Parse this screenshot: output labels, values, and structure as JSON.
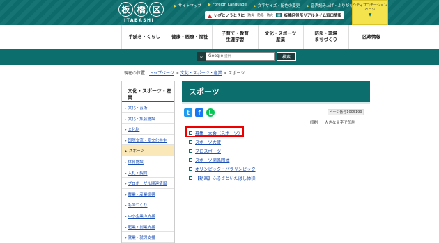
{
  "header": {
    "logo_kanji": [
      "板",
      "橋",
      "区"
    ],
    "logo_roman": "ITABASHI",
    "top_links": [
      "サイトマップ",
      "Foreign Language",
      "文字サイズ・配色の変更",
      "音声読み上げ・ふりがな"
    ],
    "emergency_label": "いざというときに",
    "emergency_sub": "(防災・防犯・防火)",
    "building_label": "板橋区役所リアルタイム窓口情報",
    "promo_text": "シティプロモーションページ"
  },
  "nav": [
    "手続き・くらし",
    "健康・医療・福祉",
    "子育て・教育\n生涯学習",
    "文化・スポーツ\n産業",
    "防災・環境\nまちづくり",
    "区政情報"
  ],
  "search": {
    "placeholder": "Google",
    "placeholder_sub": "提供",
    "button": "検索"
  },
  "breadcrumb": {
    "prefix": "現在の位置：",
    "items": [
      "トップページ",
      "文化・スポーツ・産業"
    ],
    "current": "スポーツ",
    "sep": " > "
  },
  "sidebar": {
    "heading": "文化・スポーツ・産業",
    "items": [
      "文化・芸術",
      "文化・集会施設",
      "文化財",
      "国際交流・多文化共生",
      "スポーツ",
      "体育施設",
      "入札・契約",
      "プロポーザル関連情報",
      "農業・産業振興",
      "ものづくり",
      "中小企業の支援",
      "起業・創業支援",
      "就業・就労支援"
    ],
    "active": "スポーツ"
  },
  "main": {
    "title": "スポーツ",
    "page_number": "ページ番号1005199",
    "print_label": "印刷",
    "large_print_label": "大きな文字で印刷",
    "links": [
      "募集・大会（スポーツ）",
      "スポーツ大使",
      "プロスポーツ",
      "スポーツ関係団体",
      "オリンピック・パラリンピック",
      "【動画】ふるさといたばし体操"
    ]
  },
  "colors": {
    "brand": "#0d6e6e",
    "link": "#1a4fb4",
    "highlight": "#ee0000",
    "active_bg": "#fbe8b8"
  }
}
